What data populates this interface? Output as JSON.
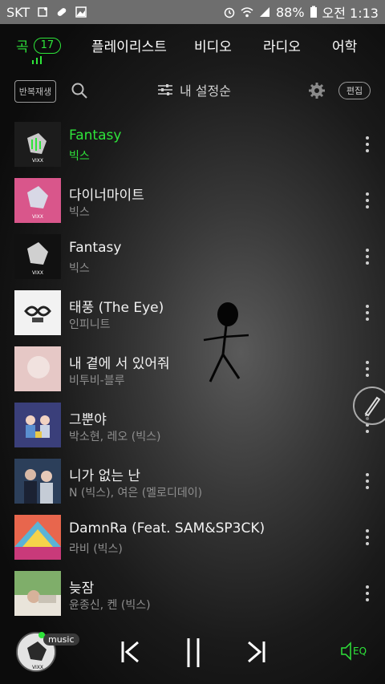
{
  "status": {
    "carrier": "SKT",
    "battery": "88%",
    "time": "오전 1:13"
  },
  "tabs": [
    {
      "label": "곡",
      "count": "17"
    },
    {
      "label": "플레이리스트"
    },
    {
      "label": "비디오"
    },
    {
      "label": "라디오"
    },
    {
      "label": "어학"
    }
  ],
  "toolbar": {
    "repeat_label": "반복재생",
    "sort_label": "내 설정순",
    "edit_label": "편집"
  },
  "songs": [
    {
      "title": "Fantasy",
      "artist": "빅스"
    },
    {
      "title": "다이너마이트",
      "artist": "빅스"
    },
    {
      "title": "Fantasy",
      "artist": "빅스"
    },
    {
      "title": "태풍 (The Eye)",
      "artist": "인피니트"
    },
    {
      "title": "내 곁에 서 있어줘",
      "artist": "비투비-블루"
    },
    {
      "title": "그뿐야",
      "artist": "박소현, 레오 (빅스)"
    },
    {
      "title": "니가 없는 난",
      "artist": "N (빅스), 여은 (멜로디데이)"
    },
    {
      "title": "DamnRa (Feat. SAM&SP3CK)",
      "artist": "라비 (빅스)"
    },
    {
      "title": "늦잠",
      "artist": "윤종신, 켄 (빅스)"
    }
  ],
  "player": {
    "tag": "music",
    "eq_label": "EQ"
  },
  "colors": {
    "accent": "#2ee43a",
    "statusbar": "#6e6e6e"
  }
}
